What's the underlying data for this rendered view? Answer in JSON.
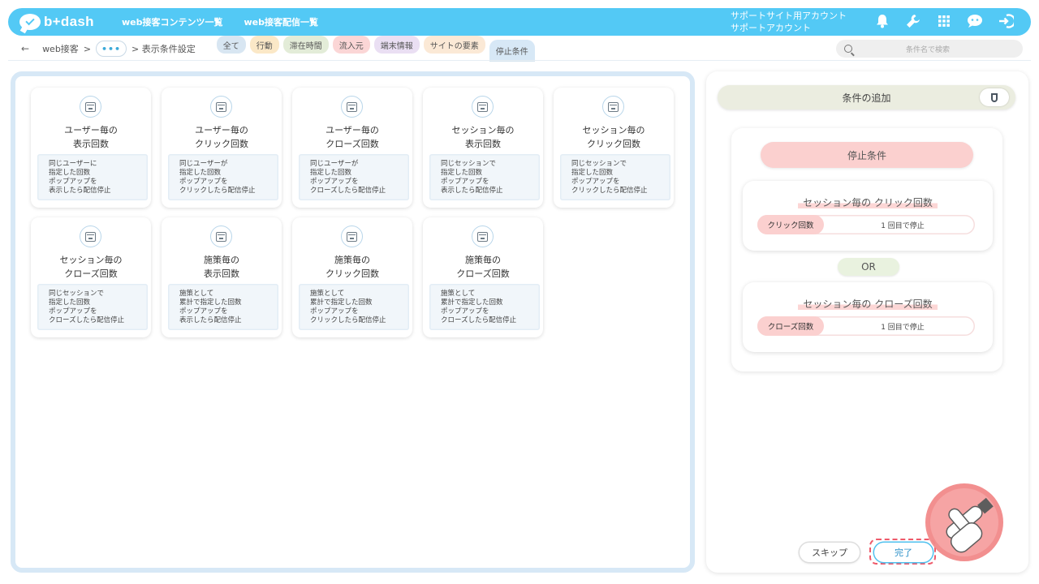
{
  "header": {
    "logo_text": "b+dash",
    "nav": [
      "web接客コンテンツ一覧",
      "web接客配信一覧"
    ],
    "account_line1": "サポートサイト用アカウント",
    "account_line2": "サポートアカウント",
    "icons": [
      "bell-icon",
      "wrench-icon",
      "grid-icon",
      "chat-icon",
      "logout-icon"
    ]
  },
  "breadcrumb": {
    "back": "←",
    "item1": "web接客",
    "sep": ">",
    "ellipsis": "•••",
    "item3": "> 表示条件設定"
  },
  "tabs": [
    {
      "label": "全て",
      "color": "#d8e6f2"
    },
    {
      "label": "行動",
      "color": "#fbe8c7"
    },
    {
      "label": "滞在時間",
      "color": "#e3ecd8"
    },
    {
      "label": "流入元",
      "color": "#fbd6d6"
    },
    {
      "label": "端末情報",
      "color": "#eadff3"
    },
    {
      "label": "サイトの要素",
      "color": "#fbe9d6"
    },
    {
      "label": "停止条件",
      "color": "#d7e8f6",
      "active": true
    }
  ],
  "search": {
    "placeholder": "条件名で検索"
  },
  "cards": [
    {
      "title1": "ユーザー毎の",
      "title2": "表示回数",
      "desc": "同じユーザーに\n指定した回数\nポップアップを\n表示したら配信停止"
    },
    {
      "title1": "ユーザー毎の",
      "title2": "クリック回数",
      "desc": "同じユーザーが\n指定した回数\nポップアップを\nクリックしたら配信停止"
    },
    {
      "title1": "ユーザー毎の",
      "title2": "クローズ回数",
      "desc": "同じユーザーが\n指定した回数\nポップアップを\nクローズしたら配信停止"
    },
    {
      "title1": "セッション毎の",
      "title2": "表示回数",
      "desc": "同じセッションで\n指定した回数\nポップアップを\n表示したら配信停止"
    },
    {
      "title1": "セッション毎の",
      "title2": "クリック回数",
      "desc": "同じセッションで\n指定した回数\nポップアップを\nクリックしたら配信停止"
    },
    {
      "title1": "セッション毎の",
      "title2": "クローズ回数",
      "desc": "同じセッションで\n指定した回数\nポップアップを\nクローズしたら配信停止"
    },
    {
      "title1": "施策毎の",
      "title2": "表示回数",
      "desc": "施策として\n累計で指定した回数\nポップアップを\n表示したら配信停止"
    },
    {
      "title1": "施策毎の",
      "title2": "クリック回数",
      "desc": "施策として\n累計で指定した回数\nポップアップを\nクリックしたら配信停止"
    },
    {
      "title1": "施策毎の",
      "title2": "クローズ回数",
      "desc": "施策として\n累計で指定した回数\nポップアップを\nクローズしたら配信停止"
    }
  ],
  "right": {
    "add_label": "条件の追加",
    "stop_label": "停止条件",
    "cond1": {
      "title": "セッション毎の クリック回数",
      "label": "クリック回数",
      "value": "1 回目で停止"
    },
    "or_label": "OR",
    "cond2": {
      "title": "セッション毎の クローズ回数",
      "label": "クローズ回数",
      "value": "1 回目で停止"
    },
    "skip_label": "スキップ",
    "done_label": "完了"
  }
}
